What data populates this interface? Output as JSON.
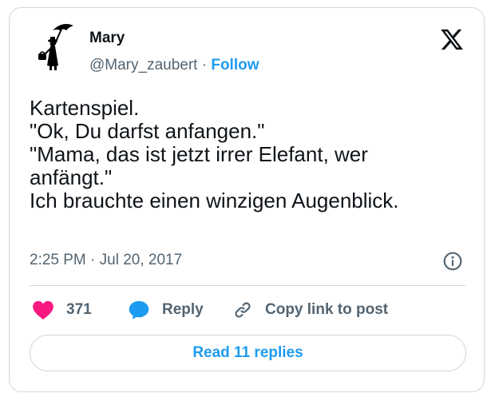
{
  "author": {
    "name": "Mary",
    "handle": "@Mary_zaubert",
    "separator": "·",
    "follow_label": "Follow"
  },
  "tweet": {
    "lines": [
      "Kartenspiel.",
      "\"Ok, Du darfst anfangen.\"",
      "\"Mama, das ist jetzt irrer Elefant, wer",
      "anfängt.\"",
      "Ich brauchte einen winzigen Augenblick."
    ],
    "time": "2:25 PM",
    "date": "Jul 20, 2017",
    "meta_separator": "·"
  },
  "actions": {
    "likes": "371",
    "reply_label": "Reply",
    "copy_label": "Copy link to post"
  },
  "footer": {
    "read_replies_label": "Read 11 replies"
  },
  "icons": {
    "brand": "x-logo-icon",
    "like": "heart-icon",
    "reply": "speech-bubble-icon",
    "copy": "link-icon",
    "info": "info-icon"
  },
  "colors": {
    "accent": "#1d9bf0",
    "like": "#f91880",
    "muted": "#536471",
    "border": "#cfd9de",
    "text": "#0f1419"
  }
}
